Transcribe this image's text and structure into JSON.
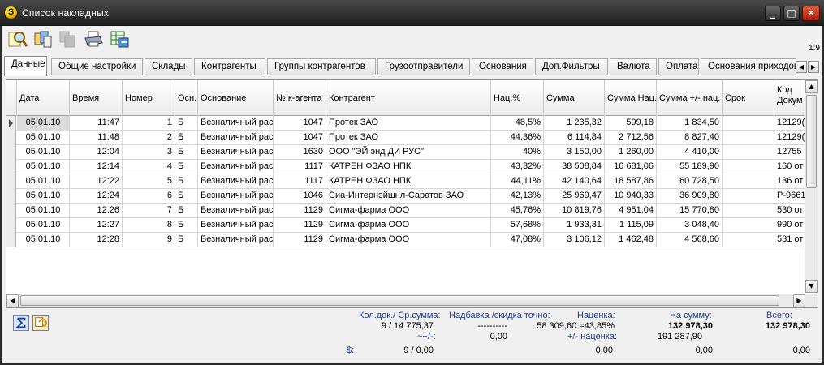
{
  "window": {
    "title": "Список накладных",
    "app_icon_letter": "S",
    "min": "_",
    "max": "□",
    "close": "✕"
  },
  "toolbar": {
    "zoom": "1:9"
  },
  "tabs": [
    {
      "label": "Данные",
      "active": true
    },
    {
      "label": "Общие настройки"
    },
    {
      "label": "Склады"
    },
    {
      "label": "Контрагенты"
    },
    {
      "label": "Группы контрагентов"
    },
    {
      "label": "Грузоотправители"
    },
    {
      "label": "Основания"
    },
    {
      "label": "Доп.Фильтры"
    },
    {
      "label": "Валюта"
    },
    {
      "label": "Оплата"
    },
    {
      "label": "Основания приходов"
    }
  ],
  "columns": [
    {
      "label": "Дата"
    },
    {
      "label": "Время"
    },
    {
      "label": "Номер"
    },
    {
      "label": "Осн."
    },
    {
      "label": "Основание"
    },
    {
      "label": "№ к-агента"
    },
    {
      "label": "Контрагент"
    },
    {
      "label": "Нац.%"
    },
    {
      "label": "Сумма"
    },
    {
      "label": "Сумма Нац."
    },
    {
      "label": "Сумма +/- нац."
    },
    {
      "label": "Срок"
    },
    {
      "label": "Код Докум"
    }
  ],
  "rows": [
    [
      "05.01.10",
      "11:47",
      "1",
      "Б",
      "Безналичный рас",
      "1047",
      "Протек ЗАО",
      "48,5%",
      "1 235,32",
      "599,18",
      "1 834,50",
      "",
      "12129("
    ],
    [
      "05.01.10",
      "11:48",
      "2",
      "Б",
      "Безналичный рас",
      "1047",
      "Протек ЗАО",
      "44,36%",
      "6 114,84",
      "2 712,56",
      "8 827,40",
      "",
      "12129("
    ],
    [
      "05.01.10",
      "12:04",
      "3",
      "Б",
      "Безналичный рас",
      "1630",
      "ООО \"ЭЙ энд ДИ РУС\"",
      "40%",
      "3 150,00",
      "1 260,00",
      "4 410,00",
      "",
      "12755"
    ],
    [
      "05.01.10",
      "12:14",
      "4",
      "Б",
      "Безналичный рас",
      "1117",
      "КАТРЕН ФЗАО НПК",
      "43,32%",
      "38 508,84",
      "16 681,06",
      "55 189,90",
      "",
      "160 от"
    ],
    [
      "05.01.10",
      "12:22",
      "5",
      "Б",
      "Безналичный рас",
      "1117",
      "КАТРЕН ФЗАО НПК",
      "44,11%",
      "42 140,64",
      "18 587,86",
      "60 728,50",
      "",
      "136 от"
    ],
    [
      "05.01.10",
      "12:24",
      "6",
      "Б",
      "Безналичный рас",
      "1046",
      "Сиа-Интернэйшнл-Саратов ЗАО",
      "42,13%",
      "25 969,47",
      "10 940,33",
      "36 909,80",
      "",
      "Р-9661"
    ],
    [
      "05.01.10",
      "12:26",
      "7",
      "Б",
      "Безналичный рас",
      "1129",
      "Сигма-фарма ООО",
      "45,76%",
      "10 819,76",
      "4 951,04",
      "15 770,80",
      "",
      "530 от"
    ],
    [
      "05.01.10",
      "12:27",
      "8",
      "Б",
      "Безналичный рас",
      "1129",
      "Сигма-фарма ООО",
      "57,68%",
      "1 933,31",
      "1 115,09",
      "3 048,40",
      "",
      "990 от"
    ],
    [
      "05.01.10",
      "12:28",
      "9",
      "Б",
      "Безналичный рас",
      "1129",
      "Сигма-фарма ООО",
      "47,08%",
      "3 106,12",
      "1 462,48",
      "4 568,60",
      "",
      "531 от"
    ]
  ],
  "footer": {
    "count_label": "Кол.док./ Ср.сумма:",
    "count_value": "9 / 14 775,37",
    "approx_label": "~+/-:",
    "dollar_label": "$:",
    "dollar_value": "9 / 0,00",
    "markup_exact_label": "Надбавка /скидка точно:",
    "markup_exact_dashes": "----------",
    "markup_exact_value": "58 309,60 =43,85%",
    "approx_value": "0,00",
    "markup_label": "Наценка:",
    "pm_markup_label": "+/- наценка:",
    "mid_dollar_value": "0,00",
    "sum_label": "На сумму:",
    "sum_value": "132 978,30",
    "sum_pm_value": "191 287,90",
    "sum_dollar_value": "0,00",
    "total_label": "Всего:",
    "total_value": "132 978,30",
    "total_dollar_value": "0,00"
  }
}
